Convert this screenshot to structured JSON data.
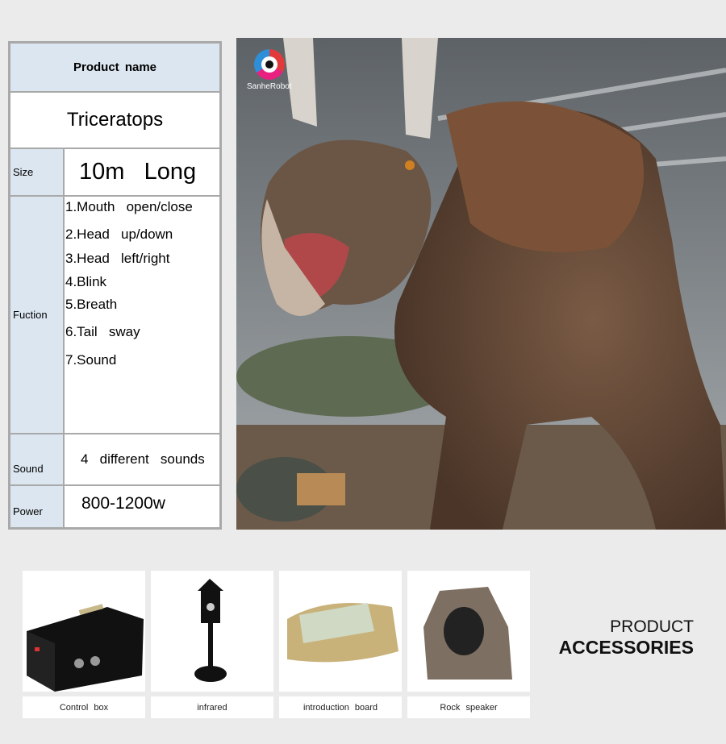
{
  "table": {
    "header": "Product  name",
    "product_name": "Triceratops",
    "size_label": "Size",
    "size_value": "10m   Long",
    "function_label": "Fuction",
    "functions": [
      "1.Mouth   open/close",
      "2.Head   up/down",
      "3.Head   left/right",
      "4.Blink",
      "5.Breath",
      "6.Tail   sway",
      "7.Sound"
    ],
    "sound_label": "Sound",
    "sound_value": "4   different   sounds",
    "power_label": "Power",
    "power_value": "800-1200w"
  },
  "photo": {
    "logo_text": "SanheRobot"
  },
  "accessories": {
    "title_line1": "PRODUCT",
    "title_line2": "ACCESSORIES",
    "items": [
      {
        "label": "Control  box"
      },
      {
        "label": "infrared"
      },
      {
        "label": "introduction  board"
      },
      {
        "label": "Rock  speaker"
      }
    ]
  }
}
